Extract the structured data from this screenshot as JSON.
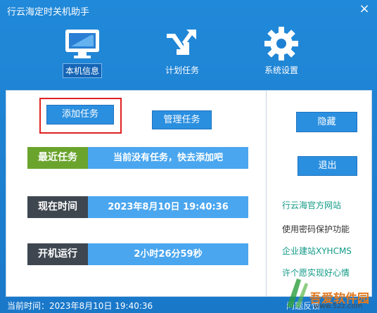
{
  "window": {
    "title": "行云海定时关机助手",
    "close": "×"
  },
  "toolbar": {
    "items": [
      {
        "label": "本机信息",
        "icon": "monitor-icon"
      },
      {
        "label": "计划任务",
        "icon": "arrows-icon"
      },
      {
        "label": "系统设置",
        "icon": "gear-icon"
      }
    ],
    "active_index": 0
  },
  "tasks": {
    "add_label": "添加任务",
    "manage_label": "管理任务"
  },
  "rows": [
    {
      "label": "最近任务",
      "value": "当前没有任务，快去添加吧",
      "label_color": "#6aa42d"
    },
    {
      "label": "现在时间",
      "value": "2023年8月10日  19:40:36",
      "label_color": "#3e4650"
    },
    {
      "label": "开机运行",
      "value": "2小时26分59秒",
      "label_color": "#3e4650"
    }
  ],
  "side": {
    "hide_label": "隐藏",
    "exit_label": "退出",
    "links": [
      "行云海官方网站",
      "使用密码保护功能",
      "企业建站XYHCMS",
      "许个愿实现好心情"
    ]
  },
  "status": {
    "text": "当前时间：2023年8月10日 19:40:36",
    "right": "问题反馈"
  },
  "watermark": {
    "title": "吾爱软件园",
    "sub": "www.52z.com"
  }
}
